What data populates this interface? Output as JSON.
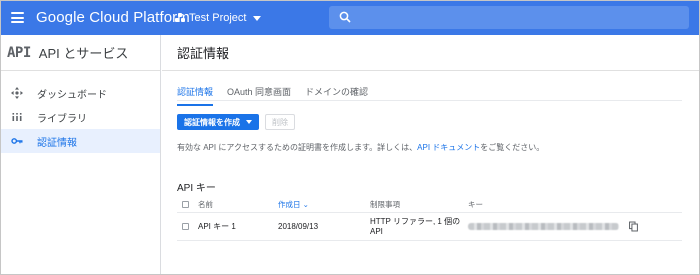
{
  "header": {
    "brand": "Google Cloud Platform",
    "project": "Test Project",
    "accent_color": "#3b78e7",
    "icons": {
      "menu": "hamburger-menu-icon",
      "project": "project-dots-icon",
      "search": "search-icon"
    }
  },
  "sidebar": {
    "logo": "API",
    "title": "API とサービス",
    "items": [
      {
        "label": "ダッシュボード",
        "icon": "dashboard-icon",
        "active": false
      },
      {
        "label": "ライブラリ",
        "icon": "library-icon",
        "active": false
      },
      {
        "label": "認証情報",
        "icon": "key-icon",
        "active": true
      }
    ]
  },
  "main": {
    "page_title": "認証情報",
    "tabs": [
      {
        "label": "認証情報",
        "active": true
      },
      {
        "label": "OAuth 同意画面",
        "active": false
      },
      {
        "label": "ドメインの確認",
        "active": false
      }
    ],
    "create_button": "認証情報を作成",
    "delete_button": "削除",
    "info": {
      "before": "有効な API にアクセスするための証明書を作成します。詳しくは、",
      "link": "API ドキュメント",
      "after": "をご覧ください。"
    },
    "section_title": "API キー",
    "table": {
      "headers": {
        "name": "名前",
        "date": "作成日",
        "restrictions": "制限事項",
        "key": "キー"
      },
      "rows": [
        {
          "name": "API キー 1",
          "date": "2018/09/13",
          "restrictions": "HTTP リファラー, 1 個の API"
        }
      ]
    }
  }
}
